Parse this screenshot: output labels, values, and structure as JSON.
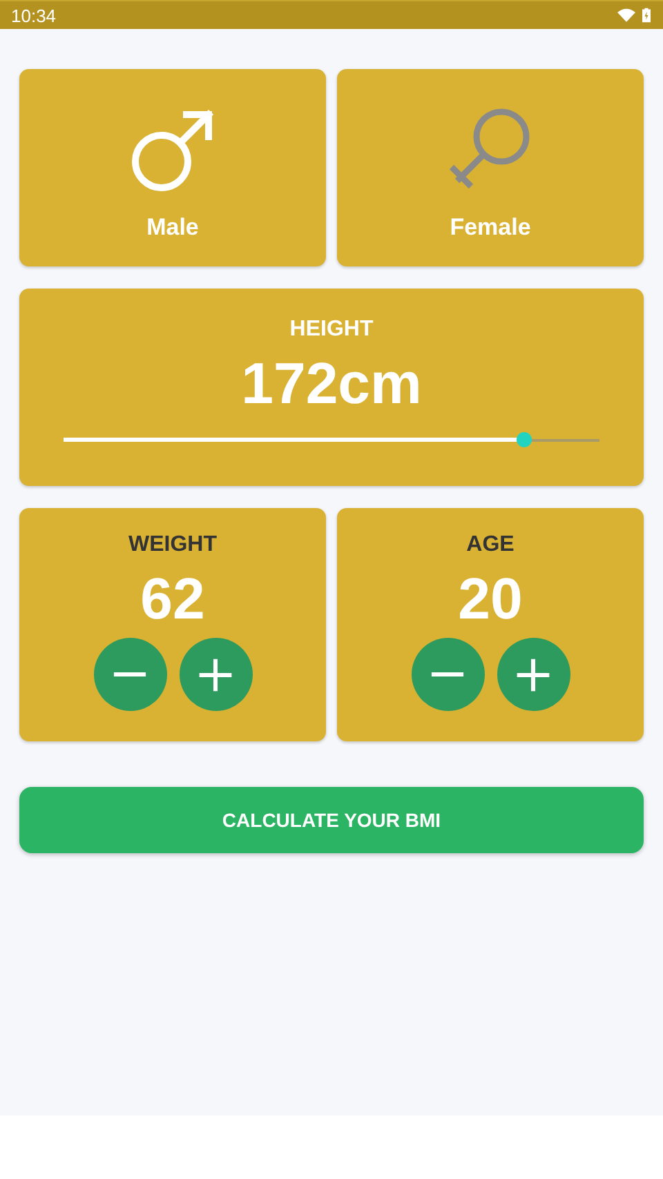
{
  "status_bar": {
    "time": "10:34"
  },
  "genders": [
    {
      "kind": "male",
      "label": "Male",
      "selected": true
    },
    {
      "kind": "female",
      "label": "Female",
      "selected": false
    }
  ],
  "height": {
    "label": "HEIGHT",
    "value": "172cm",
    "level": 0.86
  },
  "counters": [
    {
      "label": "WEIGHT",
      "value": "62"
    },
    {
      "label": "AGE",
      "value": "20"
    }
  ],
  "action_button": "CALCULATE YOUR BMI"
}
